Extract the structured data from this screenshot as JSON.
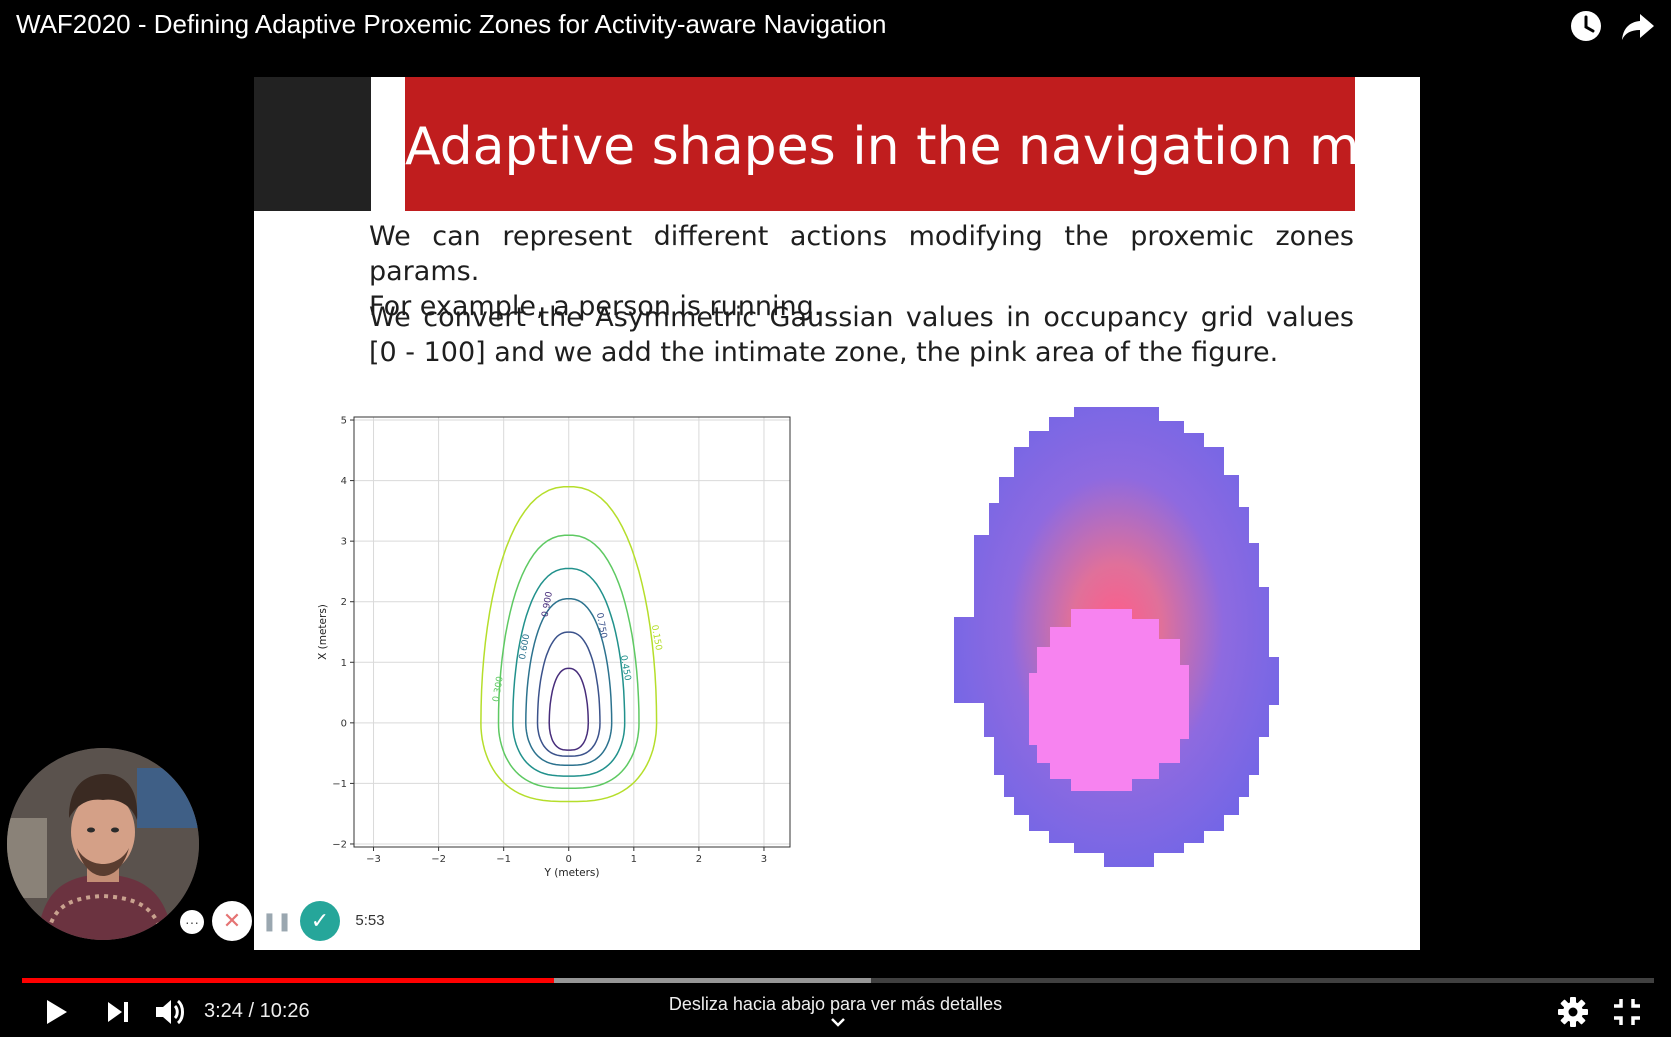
{
  "header": {
    "title": "WAF2020 - Defining Adaptive Proxemic Zones for Activity-aware Navigation",
    "icons": [
      "clock-icon",
      "share-icon"
    ]
  },
  "slide": {
    "title": "Adaptive shapes in the navigation map",
    "para1_line1": "We can represent different actions modifying the proxemic zones params.",
    "para1_line2": "For example, a person is running.",
    "para2_line1": "We convert the Asymmetric Gaussian values in occupancy grid values",
    "para2_line2": "[0 - 100] and we add the intimate zone, the pink area of the figure.",
    "colors": {
      "banner": "#c01d1e",
      "corner": "#222222",
      "heat_outer": "#7366e6",
      "heat_center": "#f282ea"
    }
  },
  "chart_data": {
    "type": "contour",
    "xlabel": "Y (meters)",
    "ylabel": "X (meters)",
    "xlim": [
      -3.3,
      3.4
    ],
    "ylim": [
      -2.05,
      5.05
    ],
    "xticks": [
      "-3",
      "-2",
      "-1",
      "0",
      "1",
      "2",
      "3"
    ],
    "yticks": [
      "-2",
      "-1",
      "0",
      "1",
      "2",
      "3",
      "4",
      "5"
    ],
    "grid": true,
    "levels": [
      {
        "value": 0.15,
        "label": "0.150",
        "color": "#b5de2b",
        "x_half_width": 1.35,
        "top": 3.9,
        "bottom": -1.3
      },
      {
        "value": 0.3,
        "label": "0.300",
        "color": "#5ec962",
        "x_half_width": 1.08,
        "top": 3.1,
        "bottom": -1.08
      },
      {
        "value": 0.45,
        "label": "0.450",
        "color": "#21918c",
        "x_half_width": 0.86,
        "top": 2.55,
        "bottom": -0.88
      },
      {
        "value": 0.6,
        "label": "0.600",
        "color": "#2c728e",
        "x_half_width": 0.66,
        "top": 2.05,
        "bottom": -0.7
      },
      {
        "value": 0.75,
        "label": "0.750",
        "color": "#3b528b",
        "x_half_width": 0.48,
        "top": 1.5,
        "bottom": -0.55
      },
      {
        "value": 0.9,
        "label": "0.900",
        "color": "#472d7b",
        "x_half_width": 0.3,
        "top": 0.9,
        "bottom": -0.45
      }
    ]
  },
  "player": {
    "current_time": "3:24",
    "duration": "10:26",
    "time_text": "3:24 / 10:26",
    "played_fraction": 0.326,
    "buffered_fraction": 0.52,
    "hint": "Desliza hacia abajo para ver más detalles"
  },
  "recorder": {
    "timer": "5:53",
    "more_label": "···"
  }
}
